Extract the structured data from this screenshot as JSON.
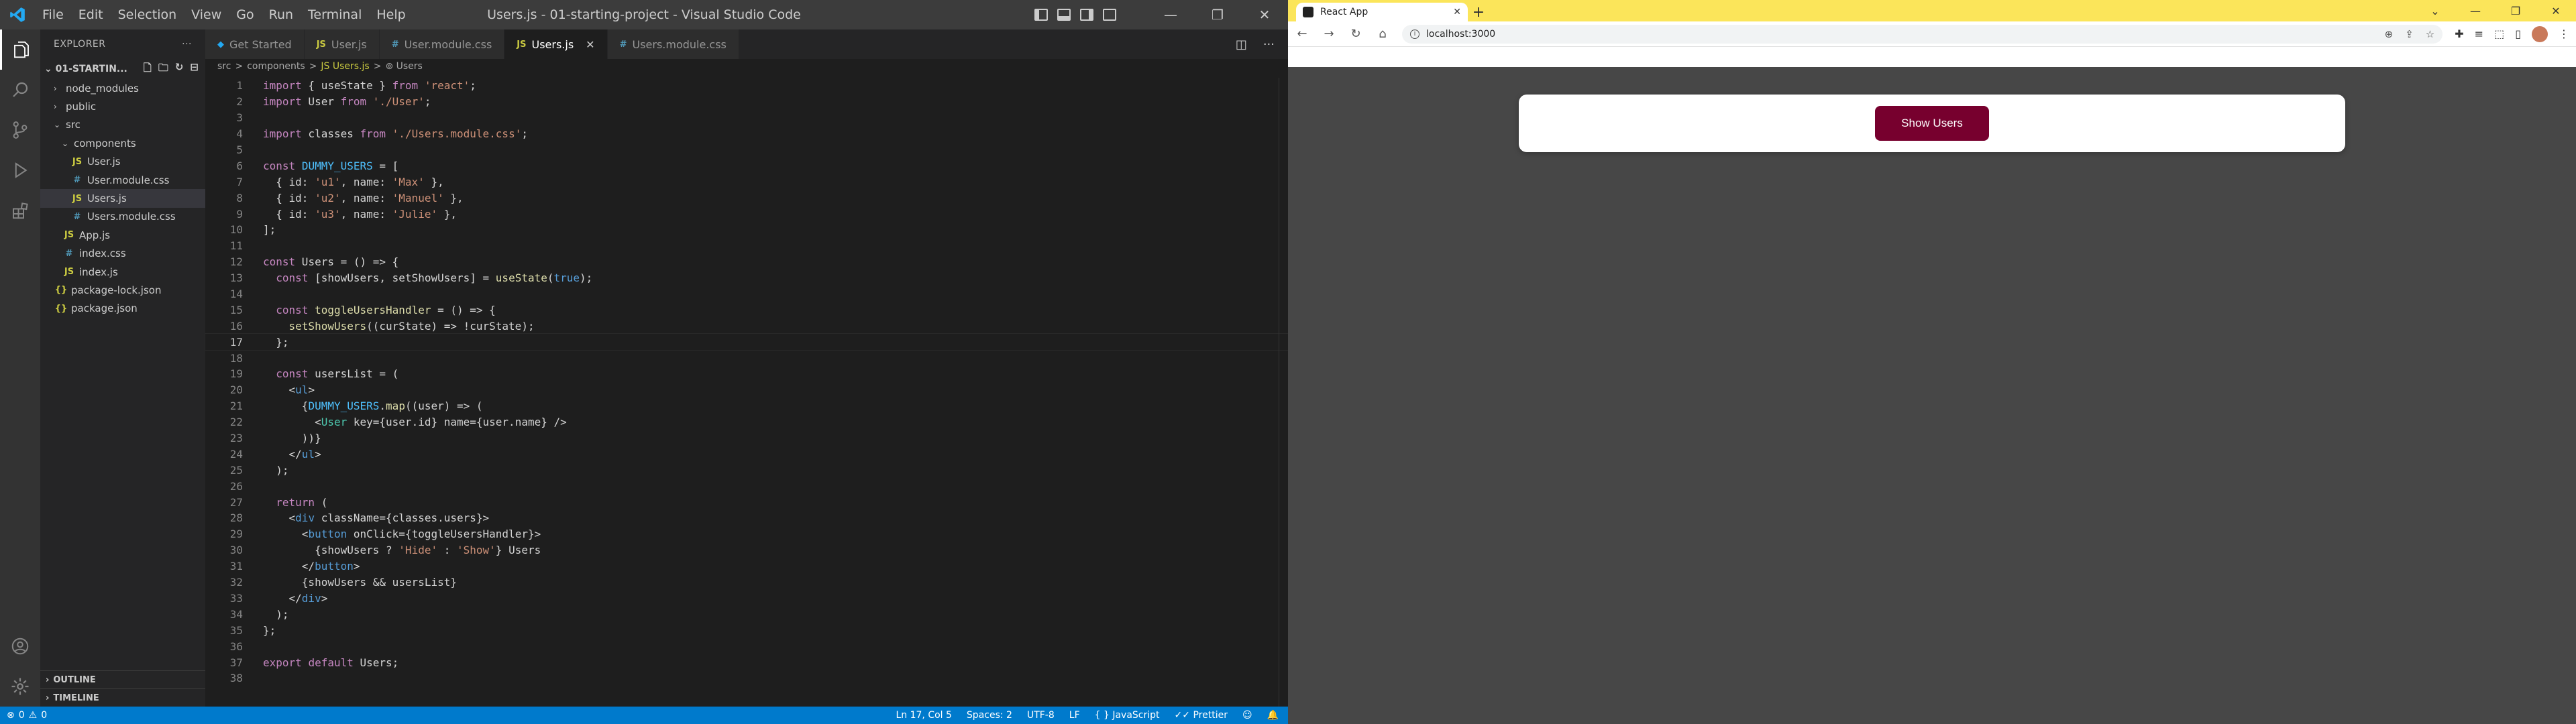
{
  "vscode": {
    "title": "Users.js - 01-starting-project - Visual Studio Code",
    "menu": [
      "File",
      "Edit",
      "Selection",
      "View",
      "Go",
      "Run",
      "Terminal",
      "Help"
    ],
    "explorer_header": "EXPLORER",
    "project_name": "01-STARTIN...",
    "tree": [
      {
        "label": "node_modules",
        "type": "folder",
        "indent": 1,
        "open": false
      },
      {
        "label": "public",
        "type": "folder",
        "indent": 1,
        "open": false
      },
      {
        "label": "src",
        "type": "folder",
        "indent": 1,
        "open": true
      },
      {
        "label": "components",
        "type": "folder",
        "indent": 2,
        "open": true
      },
      {
        "label": "User.js",
        "type": "js",
        "indent": 3
      },
      {
        "label": "User.module.css",
        "type": "css",
        "indent": 3
      },
      {
        "label": "Users.js",
        "type": "js",
        "indent": 3,
        "selected": true
      },
      {
        "label": "Users.module.css",
        "type": "css",
        "indent": 3
      },
      {
        "label": "App.js",
        "type": "js",
        "indent": 2
      },
      {
        "label": "index.css",
        "type": "css",
        "indent": 2
      },
      {
        "label": "index.js",
        "type": "js",
        "indent": 2
      },
      {
        "label": "package-lock.json",
        "type": "json",
        "indent": 1
      },
      {
        "label": "package.json",
        "type": "json",
        "indent": 1
      }
    ],
    "outline_label": "OUTLINE",
    "timeline_label": "TIMELINE",
    "tabs": [
      {
        "label": "Get Started",
        "icon": "vscode-icon",
        "active": false
      },
      {
        "label": "User.js",
        "icon": "JS",
        "active": false
      },
      {
        "label": "User.module.css",
        "icon": "#",
        "active": false
      },
      {
        "label": "Users.js",
        "icon": "JS",
        "active": true
      },
      {
        "label": "Users.module.css",
        "icon": "#",
        "active": false
      }
    ],
    "breadcrumb": [
      "src",
      ">",
      "components",
      ">",
      "JS Users.js",
      ">",
      "⊚ Users"
    ],
    "code_lines": [
      "import { useState } from 'react';",
      "import User from './User';",
      "",
      "import classes from './Users.module.css';",
      "",
      "const DUMMY_USERS = [",
      "  { id: 'u1', name: 'Max' },",
      "  { id: 'u2', name: 'Manuel' },",
      "  { id: 'u3', name: 'Julie' },",
      "];",
      "",
      "const Users = () => {",
      "  const [showUsers, setShowUsers] = useState(true);",
      "",
      "  const toggleUsersHandler = () => {",
      "    setShowUsers((curState) => !curState);",
      "  };",
      "",
      "  const usersList = (",
      "    <ul>",
      "      {DUMMY_USERS.map((user) => (",
      "        <User key={user.id} name={user.name} />",
      "      ))}",
      "    </ul>",
      "  );",
      "",
      "  return (",
      "    <div className={classes.users}>",
      "      <button onClick={toggleUsersHandler}>",
      "        {showUsers ? 'Hide' : 'Show'} Users",
      "      </button>",
      "      {showUsers && usersList}",
      "    </div>",
      "  );",
      "};",
      "",
      "export default Users;",
      ""
    ],
    "current_line": 17,
    "status": {
      "errors": "0",
      "warnings": "0",
      "position": "Ln 17, Col 5",
      "spaces": "Spaces: 2",
      "encoding": "UTF-8",
      "eol": "LF",
      "language": "JavaScript",
      "formatter": "Prettier"
    },
    "colors": {
      "statusbar": "#007acc",
      "titlebar": "#3c3c3c",
      "sidebar": "#252526",
      "editor": "#1e1e1e"
    }
  },
  "browser": {
    "tab_title": "React App",
    "url": "localhost:3000",
    "button_label": "Show Users",
    "colors": {
      "tabstrip": "#fbe55a",
      "page_bg": "#474747",
      "button": "#77002e"
    }
  }
}
